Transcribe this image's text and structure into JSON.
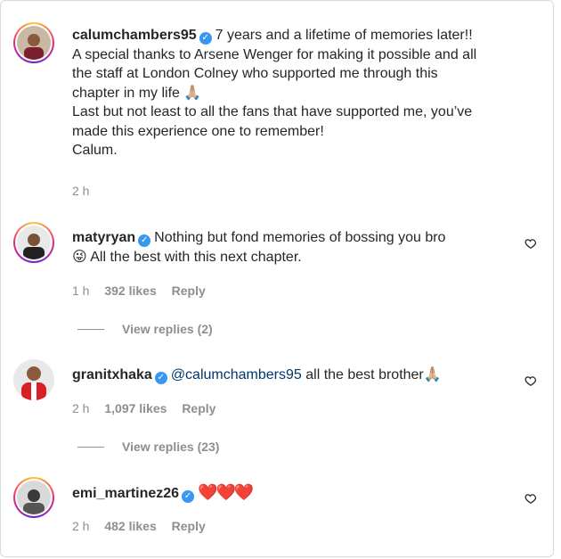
{
  "comments": [
    {
      "username": "calumchambers95",
      "verified": true,
      "text_lines": [
        "7 years and a lifetime of memories later!!",
        "A special thanks to Arsene Wenger for making it possible and all",
        "the staff at London Colney who supported me through this",
        "chapter in my life 🙏🏼",
        "Last but not least to all the fans that have supported me, you’ve",
        "made this experience one to remember!",
        "Calum."
      ],
      "time": "2 h"
    },
    {
      "username": "matyryan",
      "verified": true,
      "text_lines": [
        "Nothing but fond memories of bossing you bro",
        "😜 All the best with this next chapter."
      ],
      "time": "1 h",
      "likes": "392 likes",
      "reply": "Reply",
      "view_replies": "View replies (2)"
    },
    {
      "username": "granitxhaka",
      "verified": true,
      "mention": "@calumchambers95",
      "text": "all the best brother🙏🏼",
      "time": "2 h",
      "likes": "1,097 likes",
      "reply": "Reply",
      "view_replies": "View replies (23)"
    },
    {
      "username": "emi_martinez26",
      "verified": true,
      "text": "❤️❤️❤️",
      "time": "2 h",
      "likes": "482 likes",
      "reply": "Reply"
    }
  ],
  "icons": {
    "verified": "verified-badge-icon",
    "like": "heart-outline-icon"
  },
  "colors": {
    "verified": "#3897f0",
    "mention": "#00376b",
    "meta": "#8e8e8e"
  }
}
